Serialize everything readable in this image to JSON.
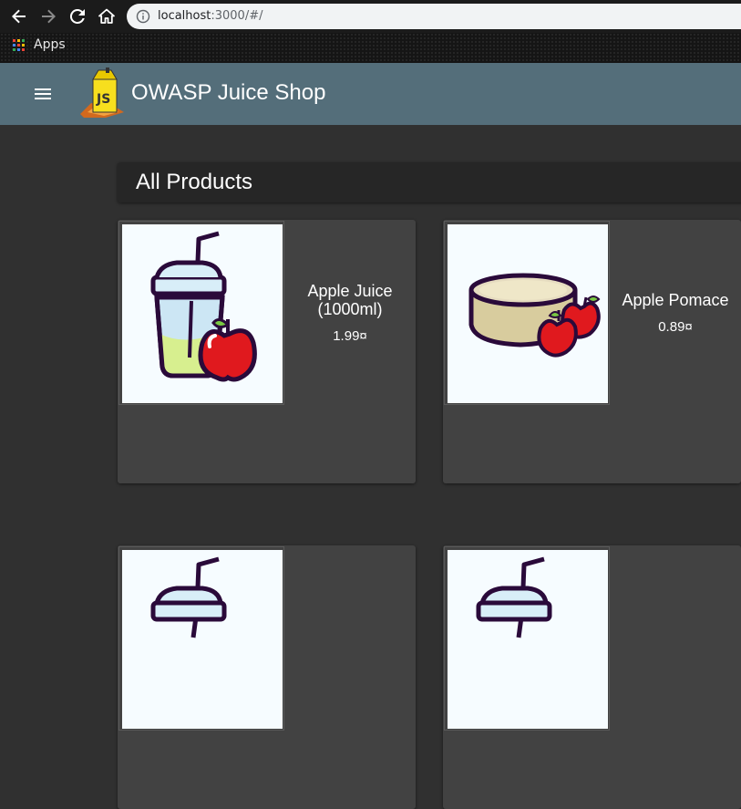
{
  "browser": {
    "url_host": "localhost",
    "url_rest": ":3000/#/",
    "bookmarks_apps_label": "Apps"
  },
  "app": {
    "title": "OWASP Juice Shop",
    "accent_color": "#546e7a"
  },
  "main": {
    "heading": "All Products",
    "products": [
      {
        "name": "Apple Juice (1000ml)",
        "price": "1.99¤"
      },
      {
        "name": "Apple Pomace",
        "price": "0.89¤"
      }
    ]
  },
  "icons": [
    "back-arrow-icon",
    "forward-arrow-icon",
    "reload-icon",
    "home-icon",
    "info-icon",
    "apps-grid-icon",
    "hamburger-menu-icon",
    "juice-shop-logo-icon"
  ]
}
